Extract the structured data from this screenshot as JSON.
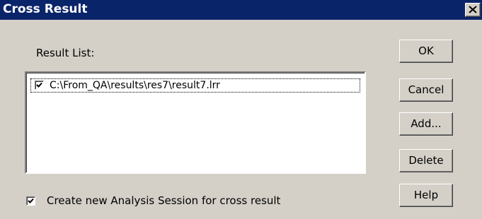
{
  "window": {
    "title": "Cross Result",
    "close_icon": "close-icon"
  },
  "result_list": {
    "label": "Result List:",
    "items": [
      {
        "path": "C:\\From_QA\\results\\res7\\result7.lrr",
        "checked": true
      }
    ]
  },
  "options": {
    "create_session_label": "Create new Analysis Session for cross result",
    "create_session_checked": true
  },
  "buttons": {
    "ok": "OK",
    "cancel": "Cancel",
    "add": "Add...",
    "delete": "Delete",
    "help": "Help"
  },
  "colors": {
    "titlebar": "#0a246a",
    "face": "#d4d0c8"
  }
}
